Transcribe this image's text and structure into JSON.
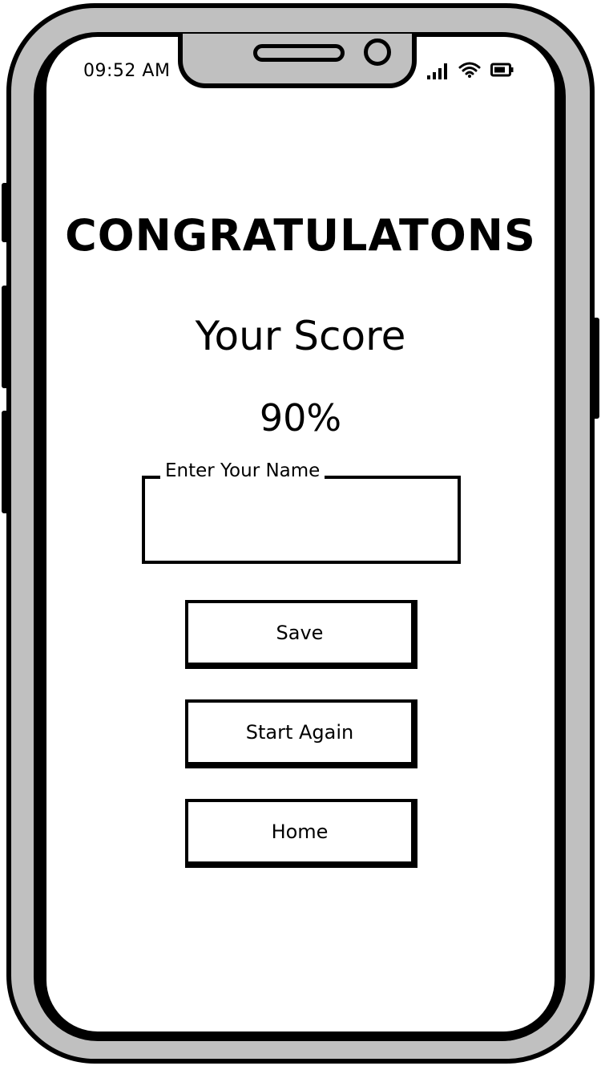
{
  "status_bar": {
    "time": "09:52 AM",
    "icons": [
      "signal-icon",
      "wifi-icon",
      "battery-icon"
    ]
  },
  "main": {
    "title": "CONGRATULATONS",
    "score_label": "Your Score",
    "score_value": "90%",
    "name_field": {
      "label": "Enter Your Name",
      "value": ""
    },
    "buttons": {
      "save": "Save",
      "start_again": "Start Again",
      "home": "Home"
    }
  },
  "colors": {
    "frame": "#c0c0c0",
    "outline": "#000000",
    "screen": "#ffffff"
  }
}
